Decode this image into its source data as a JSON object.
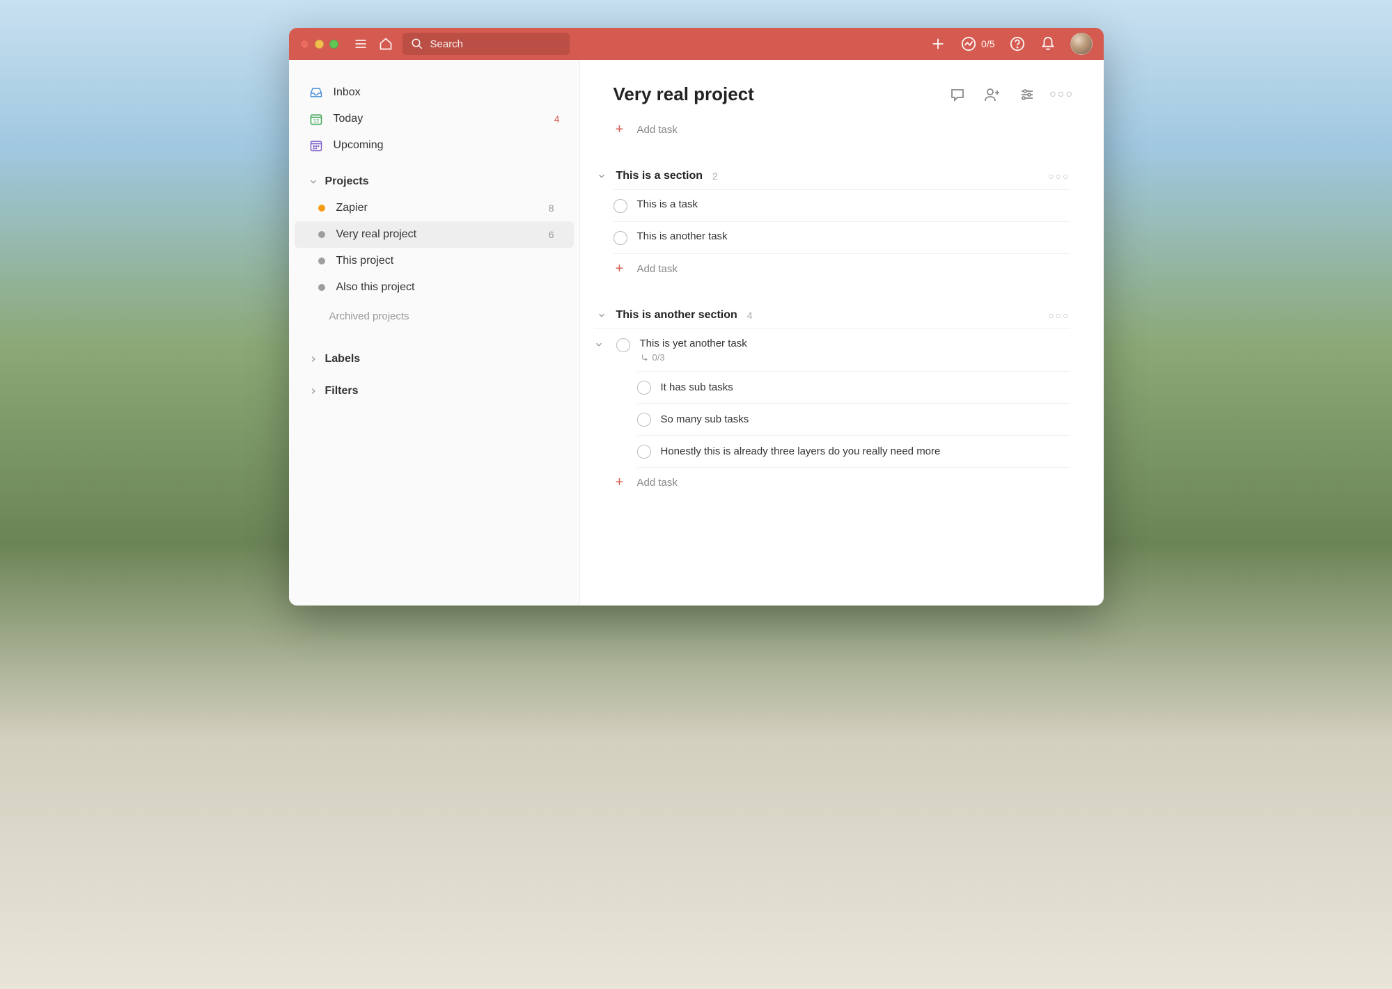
{
  "colors": {
    "accent": "#d55a4f"
  },
  "titlebar": {
    "search_placeholder": "Search",
    "progress": "0/5"
  },
  "sidebar": {
    "inbox_label": "Inbox",
    "today_label": "Today",
    "today_count": "4",
    "upcoming_label": "Upcoming",
    "projects_header": "Projects",
    "projects": [
      {
        "name": "Zapier",
        "count": "8",
        "color": "#f39c12",
        "selected": false
      },
      {
        "name": "Very real project",
        "count": "6",
        "color": "#9e9e9e",
        "selected": true
      },
      {
        "name": "This project",
        "count": "",
        "color": "#9e9e9e",
        "selected": false
      },
      {
        "name": "Also this project",
        "count": "",
        "color": "#9e9e9e",
        "selected": false
      }
    ],
    "archived_label": "Archived projects",
    "labels_header": "Labels",
    "filters_header": "Filters"
  },
  "main": {
    "project_title": "Very real project",
    "add_task_label": "Add task",
    "sections": [
      {
        "title": "This is a section",
        "count": "2",
        "tasks": [
          {
            "title": "This is a task"
          },
          {
            "title": "This is another task"
          }
        ]
      },
      {
        "title": "This is another section",
        "count": "4",
        "tasks": [
          {
            "title": "This is yet another task",
            "subtask_progress": "0/3",
            "expandable": true,
            "subtasks": [
              {
                "title": "It has sub tasks"
              },
              {
                "title": "So many sub tasks"
              },
              {
                "title": "Honestly this is already three layers do you really need more"
              }
            ]
          }
        ]
      }
    ]
  }
}
